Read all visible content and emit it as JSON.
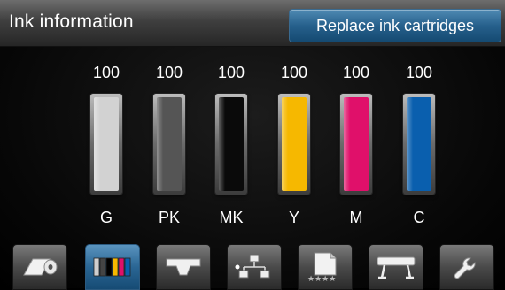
{
  "header": {
    "title": "Ink information",
    "replace_button_label": "Replace ink cartridges"
  },
  "inks": [
    {
      "code": "G",
      "level": "100",
      "color": "#d2d2d2",
      "fill": 1.0
    },
    {
      "code": "PK",
      "level": "100",
      "color": "#555555",
      "fill": 1.0
    },
    {
      "code": "MK",
      "level": "100",
      "color": "#0a0a0a",
      "fill": 1.0
    },
    {
      "code": "Y",
      "level": "100",
      "color": "#f6b800",
      "fill": 1.0
    },
    {
      "code": "M",
      "level": "100",
      "color": "#e0106a",
      "fill": 1.0
    },
    {
      "code": "C",
      "level": "100",
      "color": "#0a5fae",
      "fill": 1.0
    }
  ],
  "toolbar": {
    "items": [
      {
        "icon": "paper-roll-icon"
      },
      {
        "icon": "ink-cartridges-icon",
        "active": true
      },
      {
        "icon": "output-tray-icon"
      },
      {
        "icon": "network-icon"
      },
      {
        "icon": "print-quality-icon"
      },
      {
        "icon": "printer-icon"
      },
      {
        "icon": "wrench-icon"
      }
    ]
  }
}
